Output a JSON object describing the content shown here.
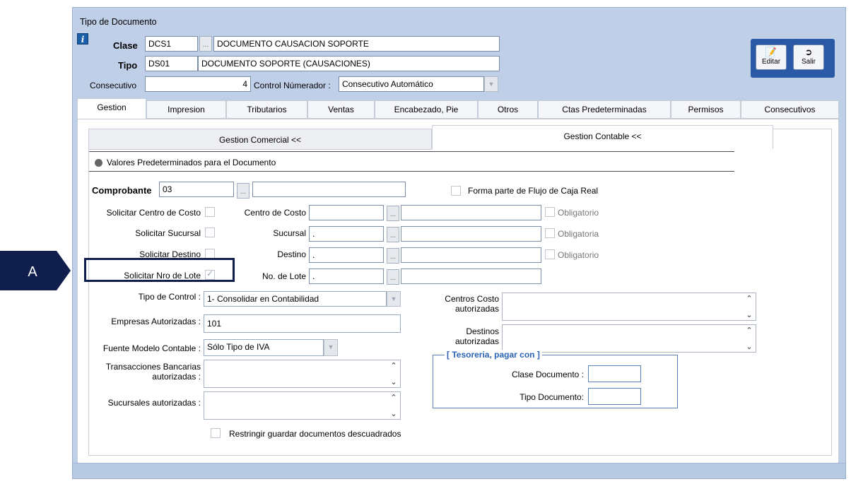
{
  "window": {
    "title": "Tipo de Documento"
  },
  "header": {
    "clase_label": "Clase",
    "clase_code": "DCS1",
    "clase_desc": "DOCUMENTO CAUSACION SOPORTE",
    "tipo_label": "Tipo",
    "tipo_code": "DS01",
    "tipo_desc": "DOCUMENTO SOPORTE (CAUSACIONES)",
    "consecutivo_label": "Consecutivo",
    "consecutivo_value": "4",
    "control_label": "Control Númerador :",
    "control_value": "Consecutivo Automático",
    "dots": "..."
  },
  "toolbar": {
    "editar": "Editar",
    "salir": "Salir"
  },
  "tabs": [
    "Gestion",
    "Impresion",
    "Tributarios",
    "Ventas",
    "Encabezado, Pie",
    "Otros",
    "Ctas Predeterminadas",
    "Permisos",
    "Consecutivos"
  ],
  "subtabs": {
    "comercial": "Gestion Comercial <<",
    "contable": "Gestion Contable <<"
  },
  "section": {
    "title": "Valores Predeterminados para el Documento"
  },
  "form": {
    "comprobante_label": "Comprobante",
    "comprobante_value": "03",
    "flujo_caja": "Forma parte de Flujo de Caja  Real",
    "sol_centro": "Solicitar Centro de Costo",
    "centro_label": "Centro de Costo",
    "obligatorio1": "Obligatorio",
    "sol_sucursal": "Solicitar Sucursal",
    "sucursal_label": "Sucursal",
    "sucursal_value": ".",
    "obligatoria": "Obligatoria",
    "sol_destino": "Solicitar Destino",
    "destino_label": "Destino",
    "destino_value": ".",
    "obligatorio2": "Obligatorio",
    "sol_lote": "Solicitar Nro de  Lote",
    "lote_label": "No. de Lote",
    "lote_value": ".",
    "tipo_control_label": "Tipo de Control :",
    "tipo_control_value": "1- Consolidar en Contabilidad",
    "empresas_label": "Empresas Autorizadas :",
    "empresas_value": "101",
    "fuente_label": "Fuente Modelo Contable :",
    "fuente_value": "Sólo Tipo de IVA",
    "transacciones_label1": "Transacciones Bancarias",
    "transacciones_label2": "autorizadas :",
    "sucursales_aut_label": "Sucursales autorizadas :",
    "centros_aut_label1": "Centros Costo",
    "centros_aut_label2": "autorizadas",
    "destinos_aut_label1": "Destinos",
    "destinos_aut_label2": "autorizadas",
    "tesoreria_title": "[  Tesoreria, pagar con  ]",
    "clase_doc_label": "Clase Documento :",
    "tipo_doc_label": "Tipo Documento:",
    "restringir": "Restringir guardar documentos descuadrados"
  },
  "callout": {
    "label": "A",
    "color": "#0f1e4c"
  }
}
